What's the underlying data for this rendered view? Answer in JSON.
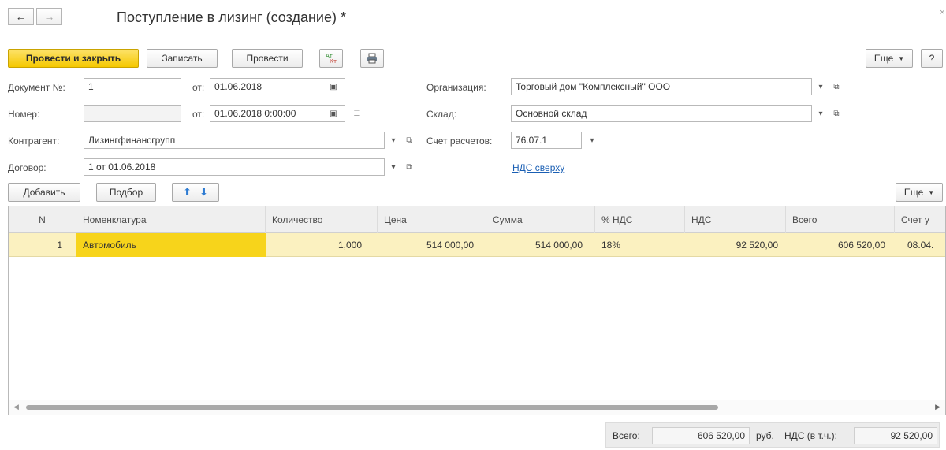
{
  "window": {
    "title": "Поступление в лизинг (создание) *",
    "close_glyph": "×"
  },
  "nav": {
    "back_icon": "arrow-left-icon",
    "forward_icon": "arrow-right-icon"
  },
  "toolbar": {
    "post_and_close": "Провести и закрыть",
    "save": "Записать",
    "post": "Провести",
    "dt_kt_icon": "dt-kt-icon",
    "print_icon": "printer-icon",
    "more": "Еще",
    "help": "?"
  },
  "form": {
    "doc_no_label": "Документ №:",
    "doc_no_value": "1",
    "from_label_1": "от:",
    "doc_date_value": "01.06.2018",
    "number_label": "Номер:",
    "number_value": "",
    "from_label_2": "от:",
    "number_date_value": "01.06.2018  0:00:00",
    "org_label": "Организация:",
    "org_value": "Торговый дом \"Комплексный\" ООО",
    "warehouse_label": "Склад:",
    "warehouse_value": "Основной склад",
    "counterparty_label": "Контрагент:",
    "counterparty_value": "Лизингфинансгрупп",
    "account_label": "Счет расчетов:",
    "account_value": "76.07.1",
    "contract_label": "Договор:",
    "contract_value": "1 от 01.06.2018",
    "vat_link": "НДС сверху"
  },
  "table_toolbar": {
    "add": "Добавить",
    "pick": "Подбор",
    "more": "Еще"
  },
  "table": {
    "columns": [
      "N",
      "Номенклатура",
      "Количество",
      "Цена",
      "Сумма",
      "% НДС",
      "НДС",
      "Всего",
      "Счет у"
    ],
    "rows": [
      [
        "1",
        "Автомобиль",
        "1,000",
        "514 000,00",
        "514 000,00",
        "18%",
        "92 520,00",
        "606 520,00",
        "08.04."
      ]
    ]
  },
  "totals": {
    "total_label": "Всего:",
    "total_value": "606 520,00",
    "currency": "руб.",
    "vat_label": "НДС (в т.ч.):",
    "vat_value": "92 520,00"
  },
  "colors": {
    "primary": "#f5c800",
    "row_highlight": "#fbf1c0",
    "link": "#1a5fb4"
  }
}
